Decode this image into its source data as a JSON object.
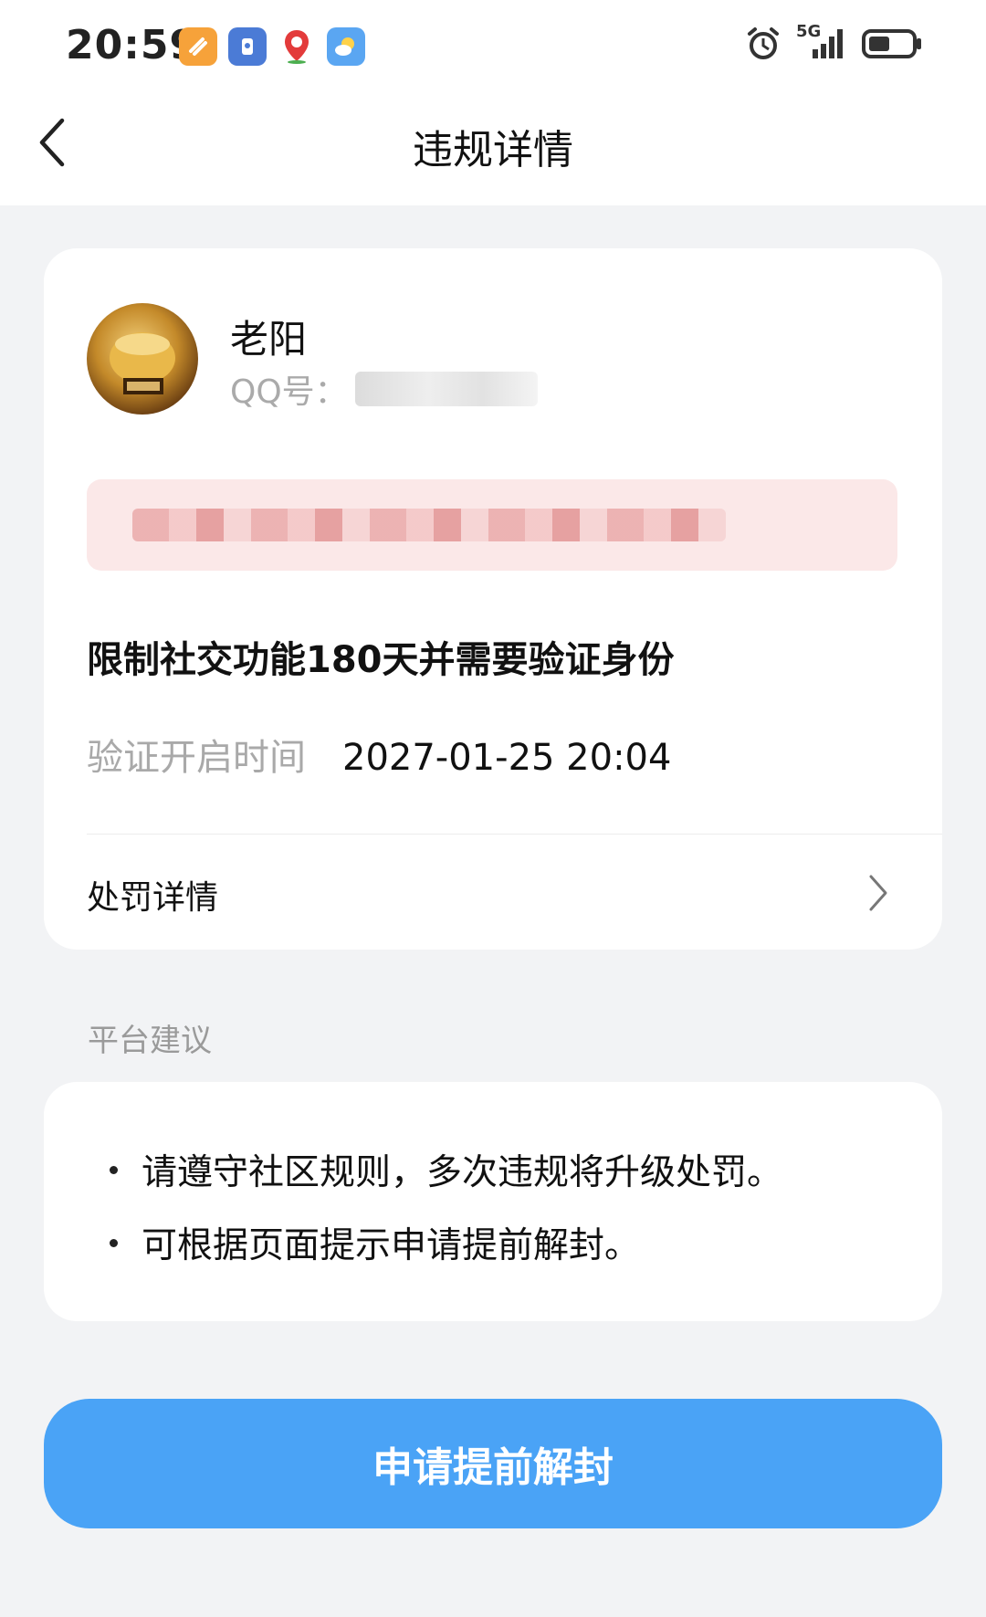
{
  "status_bar": {
    "time": "20:59",
    "network": "5G",
    "icons": [
      "app-orange-icon",
      "app-blue-icon",
      "map-pin-icon",
      "weather-icon",
      "alarm-icon",
      "signal-icon",
      "battery-icon"
    ]
  },
  "header": {
    "title": "违规详情",
    "back_icon": "chevron-left-icon"
  },
  "user": {
    "name": "老阳",
    "qq_label": "QQ号："
  },
  "penalty": {
    "title": "限制社交功能180天并需要验证身份",
    "verify_label": "验证开启时间",
    "verify_time": "2027-01-25 20:04",
    "details_label": "处罚详情"
  },
  "suggestions": {
    "section_title": "平台建议",
    "items": [
      "请遵守社区规则，多次违规将升级处罚。",
      "可根据页面提示申请提前解封。"
    ]
  },
  "action": {
    "button_label": "申请提前解封"
  },
  "colors": {
    "accent": "#4aa3f6",
    "notice_bg": "#fbe8e8",
    "page_bg": "#f2f3f5"
  }
}
